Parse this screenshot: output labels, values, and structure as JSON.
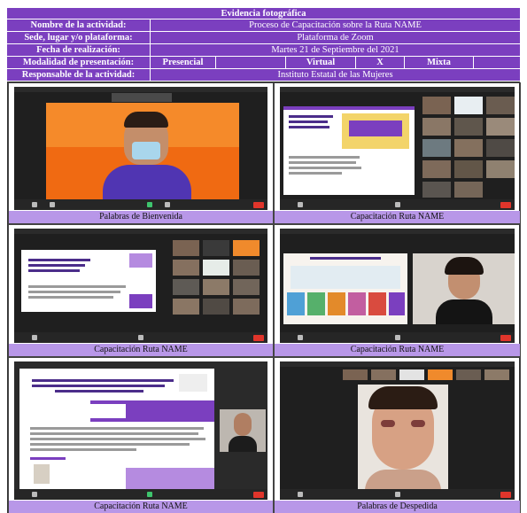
{
  "header": {
    "title": "Evidencia fotográfica",
    "rows": [
      {
        "label": "Nombre de la actividad:",
        "value": "Proceso de Capacitación sobre la Ruta NAME"
      },
      {
        "label": "Sede, lugar y/o plataforma:",
        "value": "Plataforma de Zoom"
      },
      {
        "label": "Fecha de realización:",
        "value": "Martes 21 de Septiembre del 2021"
      },
      {
        "label": "Responsable de la actividad:",
        "value": "Instituto Estatal de las Mujeres"
      }
    ],
    "modalidad": {
      "label": "Modalidad de presentación:",
      "presencial": "Presencial",
      "virtual": "Virtual",
      "mark": "X",
      "mixta": "Mixta"
    }
  },
  "photos": [
    {
      "caption": "Palabras de Bienvenida"
    },
    {
      "caption": "Capacitación Ruta NAME"
    },
    {
      "caption": "Capacitación Ruta NAME"
    },
    {
      "caption": "Capacitación Ruta NAME"
    },
    {
      "caption": "Capacitación Ruta NAME"
    },
    {
      "caption": "Palabras de Despedida"
    }
  ]
}
